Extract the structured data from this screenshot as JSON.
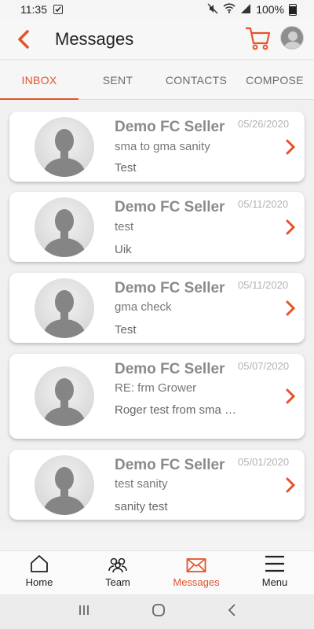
{
  "status": {
    "time": "11:35",
    "battery": "100%"
  },
  "header": {
    "title": "Messages"
  },
  "tabs": [
    {
      "label": "INBOX",
      "active": true
    },
    {
      "label": "SENT"
    },
    {
      "label": "CONTACTS"
    },
    {
      "label": "COMPOSE"
    }
  ],
  "messages": [
    {
      "sender": "Demo FC Seller",
      "subject": "sma to gma sanity",
      "preview": "Test",
      "date": "05/26/2020"
    },
    {
      "sender": "Demo FC Seller",
      "subject": "test",
      "preview": "Uik",
      "date": "05/11/2020"
    },
    {
      "sender": "Demo FC Seller",
      "subject": "gma check",
      "preview": "Test",
      "date": "05/11/2020"
    },
    {
      "sender": "Demo FC Seller",
      "subject": "RE: frm Grower",
      "preview": "Roger test from sma …",
      "date": "05/07/2020"
    },
    {
      "sender": "Demo FC Seller",
      "subject": "test sanity",
      "preview": "sanity test",
      "date": "05/01/2020"
    }
  ],
  "nav": [
    {
      "label": "Home",
      "icon": "home-icon"
    },
    {
      "label": "Team",
      "icon": "team-icon"
    },
    {
      "label": "Messages",
      "icon": "mail-icon",
      "active": true
    },
    {
      "label": "Menu",
      "icon": "menu-icon"
    }
  ],
  "colors": {
    "accent": "#e4532a"
  }
}
